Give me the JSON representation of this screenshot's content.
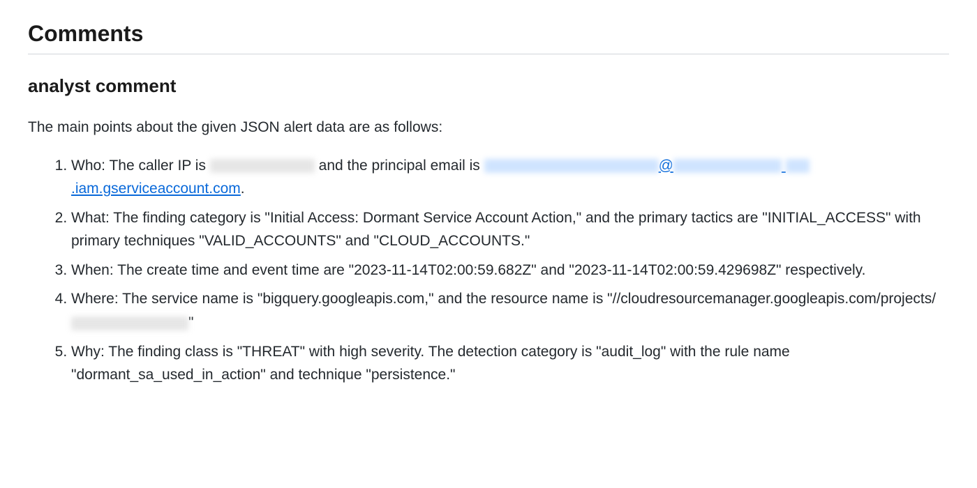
{
  "section": {
    "title": "Comments"
  },
  "comment": {
    "subtitle": "analyst comment",
    "intro": "The main points about the given JSON alert data are as follows:",
    "items": {
      "who": {
        "prefix": "Who: The caller IP is ",
        "mid": " and the principal email is ",
        "link_visible_tail": ".iam.gserviceaccount.com",
        "suffix": "."
      },
      "what": "What: The finding category is \"Initial Access: Dormant Service Account Action,\" and the primary tactics are \"INITIAL_ACCESS\" with primary techniques \"VALID_ACCOUNTS\" and \"CLOUD_ACCOUNTS.\"",
      "when": "When: The create time and event time are \"2023-11-14T02:00:59.682Z\" and \"2023-11-14T02:00:59.429698Z\" respectively.",
      "where": {
        "prefix": "Where: The service name is \"bigquery.googleapis.com,\" and the resource name is \"//cloudresourcemanager.googleapis.com/projects/",
        "suffix": "\""
      },
      "why": "Why: The finding class is \"THREAT\" with high severity. The detection category is \"audit_log\" with the rule name \"dormant_sa_used_in_action\" and technique \"persistence.\""
    }
  }
}
